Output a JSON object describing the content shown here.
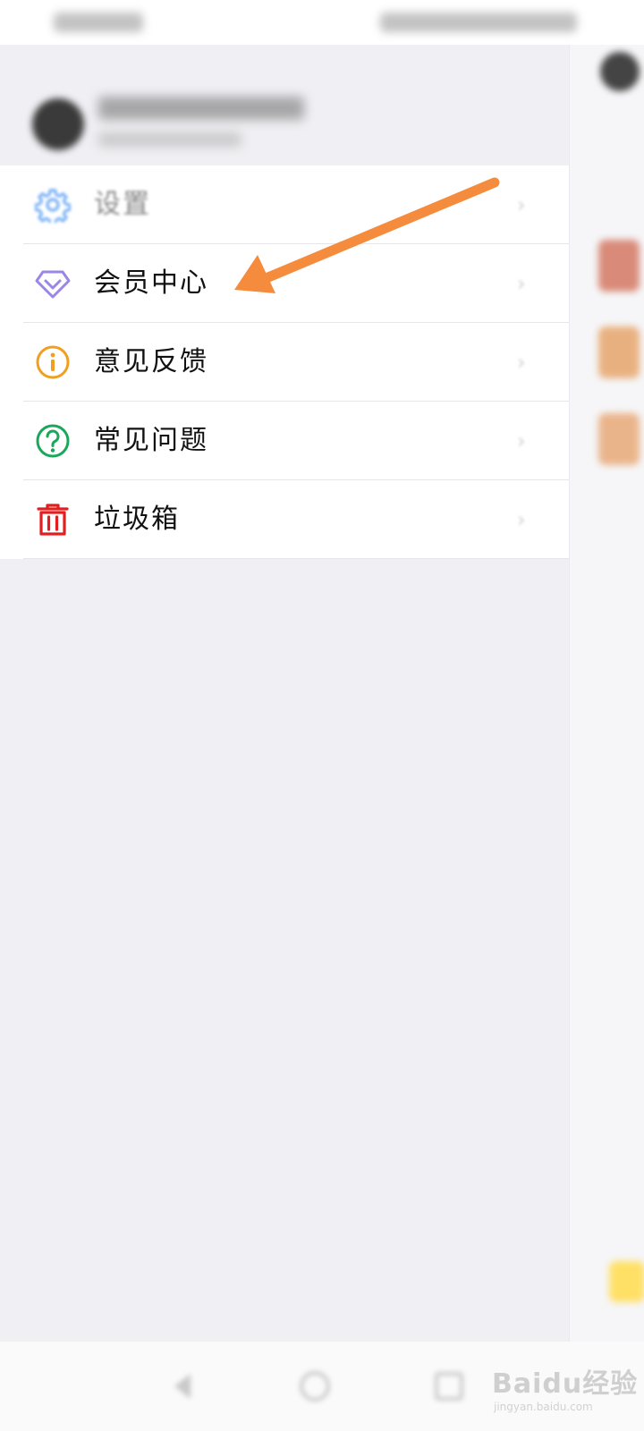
{
  "menu": {
    "items": [
      {
        "label": "设置",
        "icon": "gear-icon",
        "color": "#3d8ef5"
      },
      {
        "label": "会员中心",
        "icon": "diamond-icon",
        "color": "#9b85e6"
      },
      {
        "label": "意见反馈",
        "icon": "info-icon",
        "color": "#f0a020"
      },
      {
        "label": "常见问题",
        "icon": "question-icon",
        "color": "#19a85b"
      },
      {
        "label": "垃圾箱",
        "icon": "trash-icon",
        "color": "#e02020"
      }
    ]
  },
  "annotation": {
    "arrow_color": "#f58b3c",
    "points_to": "会员中心"
  },
  "watermark": {
    "brand": "Baidu经验",
    "url": "jingyan.baidu.com"
  }
}
